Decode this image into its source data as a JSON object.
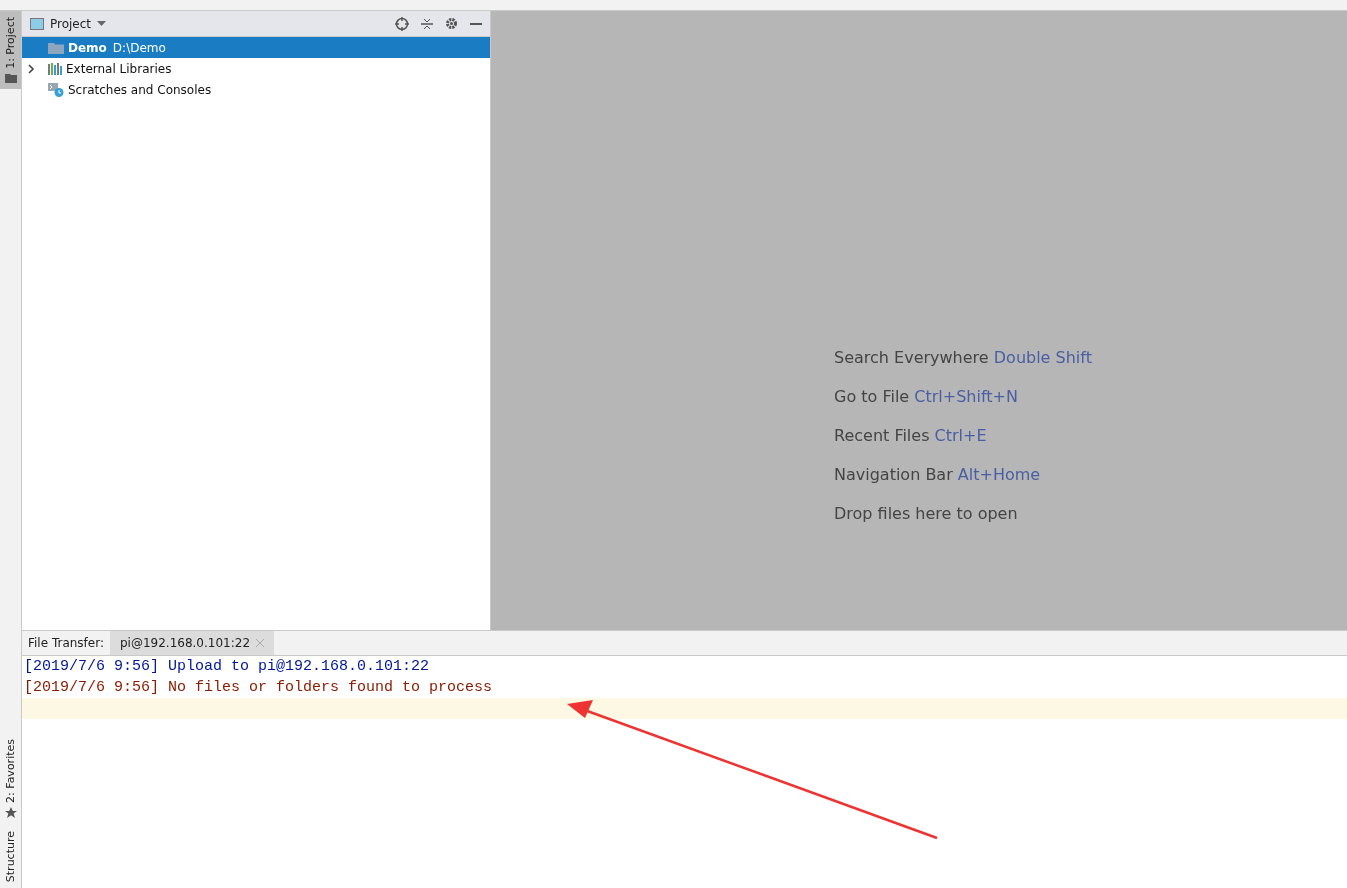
{
  "side_tabs": [
    {
      "label": "1: Project",
      "kind": "folder",
      "selected": true
    },
    {
      "label": "2: Favorites",
      "kind": "star",
      "selected": false
    },
    {
      "label": "Structure",
      "kind": "plain",
      "selected": false
    }
  ],
  "project_panel": {
    "title": "Project",
    "tree": [
      {
        "name": "Demo",
        "detail": "D:\\Demo",
        "kind": "module",
        "selected": true
      },
      {
        "name": "External Libraries",
        "kind": "libraries",
        "selected": false,
        "expanded": false
      },
      {
        "name": "Scratches and Consoles",
        "kind": "scratches",
        "selected": false
      }
    ]
  },
  "editor_hints": [
    {
      "text": "Search Everywhere",
      "shortcut": "Double Shift"
    },
    {
      "text": "Go to File",
      "shortcut": "Ctrl+Shift+N"
    },
    {
      "text": "Recent Files",
      "shortcut": "Ctrl+E"
    },
    {
      "text": "Navigation Bar",
      "shortcut": "Alt+Home"
    },
    {
      "text": "Drop files here to open"
    }
  ],
  "bottom_panel": {
    "label": "File Transfer:",
    "tabs": [
      {
        "label": "pi@192.168.0.101:22",
        "selected": true
      }
    ],
    "console": [
      {
        "text": "[2019/7/6 9:56] Upload to pi@192.168.0.101:22",
        "kind": "info"
      },
      {
        "text": "[2019/7/6 9:56] No files or folders found to process",
        "kind": "error"
      }
    ]
  }
}
